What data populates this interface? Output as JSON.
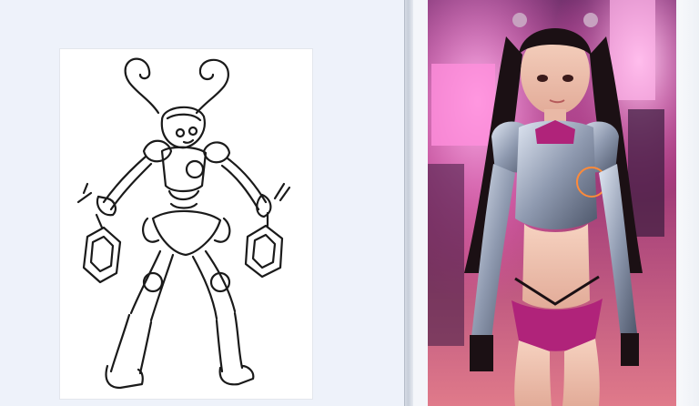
{
  "left_image": {
    "description_icon": "line-sketch-icon"
  },
  "right_image": {
    "description_icon": "rendered-photo-icon"
  },
  "colors": {
    "background": "#eef2fa",
    "sketch_paper": "#ffffff",
    "ink": "#1a1a1a",
    "neon_pink": "#ff4fbf",
    "armor_silver": "#9aa4b8",
    "armor_magenta": "#b0237a"
  }
}
